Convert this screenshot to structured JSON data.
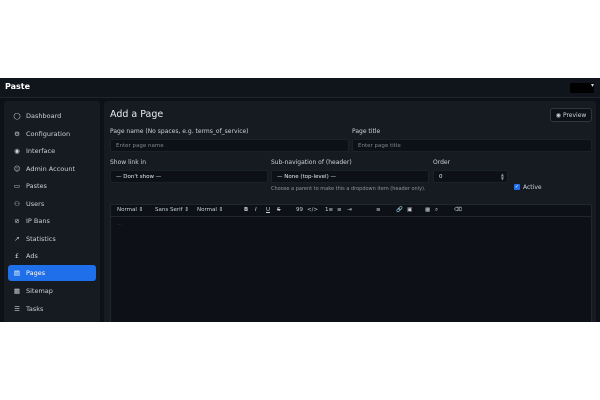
{
  "app": {
    "brand": "Paste"
  },
  "sidebar": {
    "items": [
      {
        "label": "Dashboard",
        "icon": "◯"
      },
      {
        "label": "Configuration",
        "icon": "⚙"
      },
      {
        "label": "Interface",
        "icon": "◉"
      },
      {
        "label": "Admin Account",
        "icon": "☺"
      },
      {
        "label": "Pastes",
        "icon": "▭"
      },
      {
        "label": "Users",
        "icon": "⚇"
      },
      {
        "label": "IP Bans",
        "icon": "⊘"
      },
      {
        "label": "Statistics",
        "icon": "↗"
      },
      {
        "label": "Ads",
        "icon": "£"
      },
      {
        "label": "Pages",
        "icon": "▤"
      },
      {
        "label": "Sitemap",
        "icon": "▦"
      },
      {
        "label": "Tasks",
        "icon": "☰"
      }
    ],
    "active": "Pages"
  },
  "main": {
    "title": "Add a Page",
    "preview_label": "Preview",
    "page_name": {
      "label": "Page name (No spaces, e.g. terms_of_service)",
      "placeholder": "Enter page name"
    },
    "page_title": {
      "label": "Page title",
      "placeholder": "Enter page title"
    },
    "show_link": {
      "label": "Show link in",
      "value": "— Don't show —"
    },
    "subnav": {
      "label": "Sub-navigation of (header)",
      "value": "— None (top-level) —",
      "help": "Choose a parent to make this a dropdown item (header only)."
    },
    "order": {
      "label": "Order",
      "value": "0"
    },
    "active": {
      "label": "Active",
      "checked": true
    }
  },
  "toolbar": {
    "format": "Normal",
    "font": "Sans Serif",
    "size": "Normal",
    "bold": "B",
    "italic": "I",
    "underline": "U",
    "strike": "S",
    "quote": "99",
    "code": "</>",
    "ordered_list": "1≡",
    "bullet_list": "≡",
    "indent": "⇥",
    "align": "≡",
    "link": "🔗",
    "image": "▣",
    "table": "▦",
    "search": "⌕",
    "clean": "⌫"
  }
}
